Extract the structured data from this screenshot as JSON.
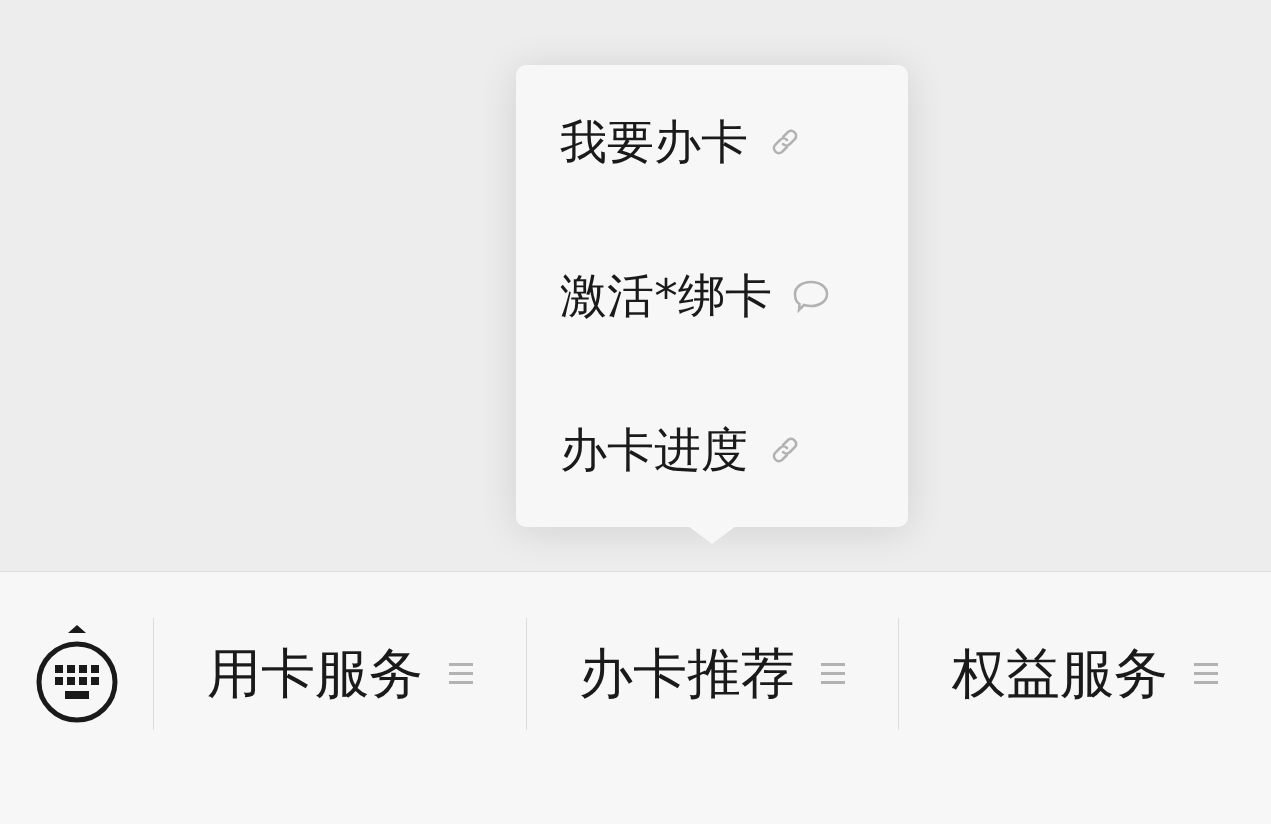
{
  "menus": [
    {
      "label": "用卡服务"
    },
    {
      "label": "办卡推荐",
      "submenu": [
        {
          "label": "我要办卡",
          "kind": "link"
        },
        {
          "label": "激活*绑卡",
          "kind": "message"
        },
        {
          "label": "办卡进度",
          "kind": "link"
        }
      ]
    },
    {
      "label": "权益服务"
    }
  ]
}
